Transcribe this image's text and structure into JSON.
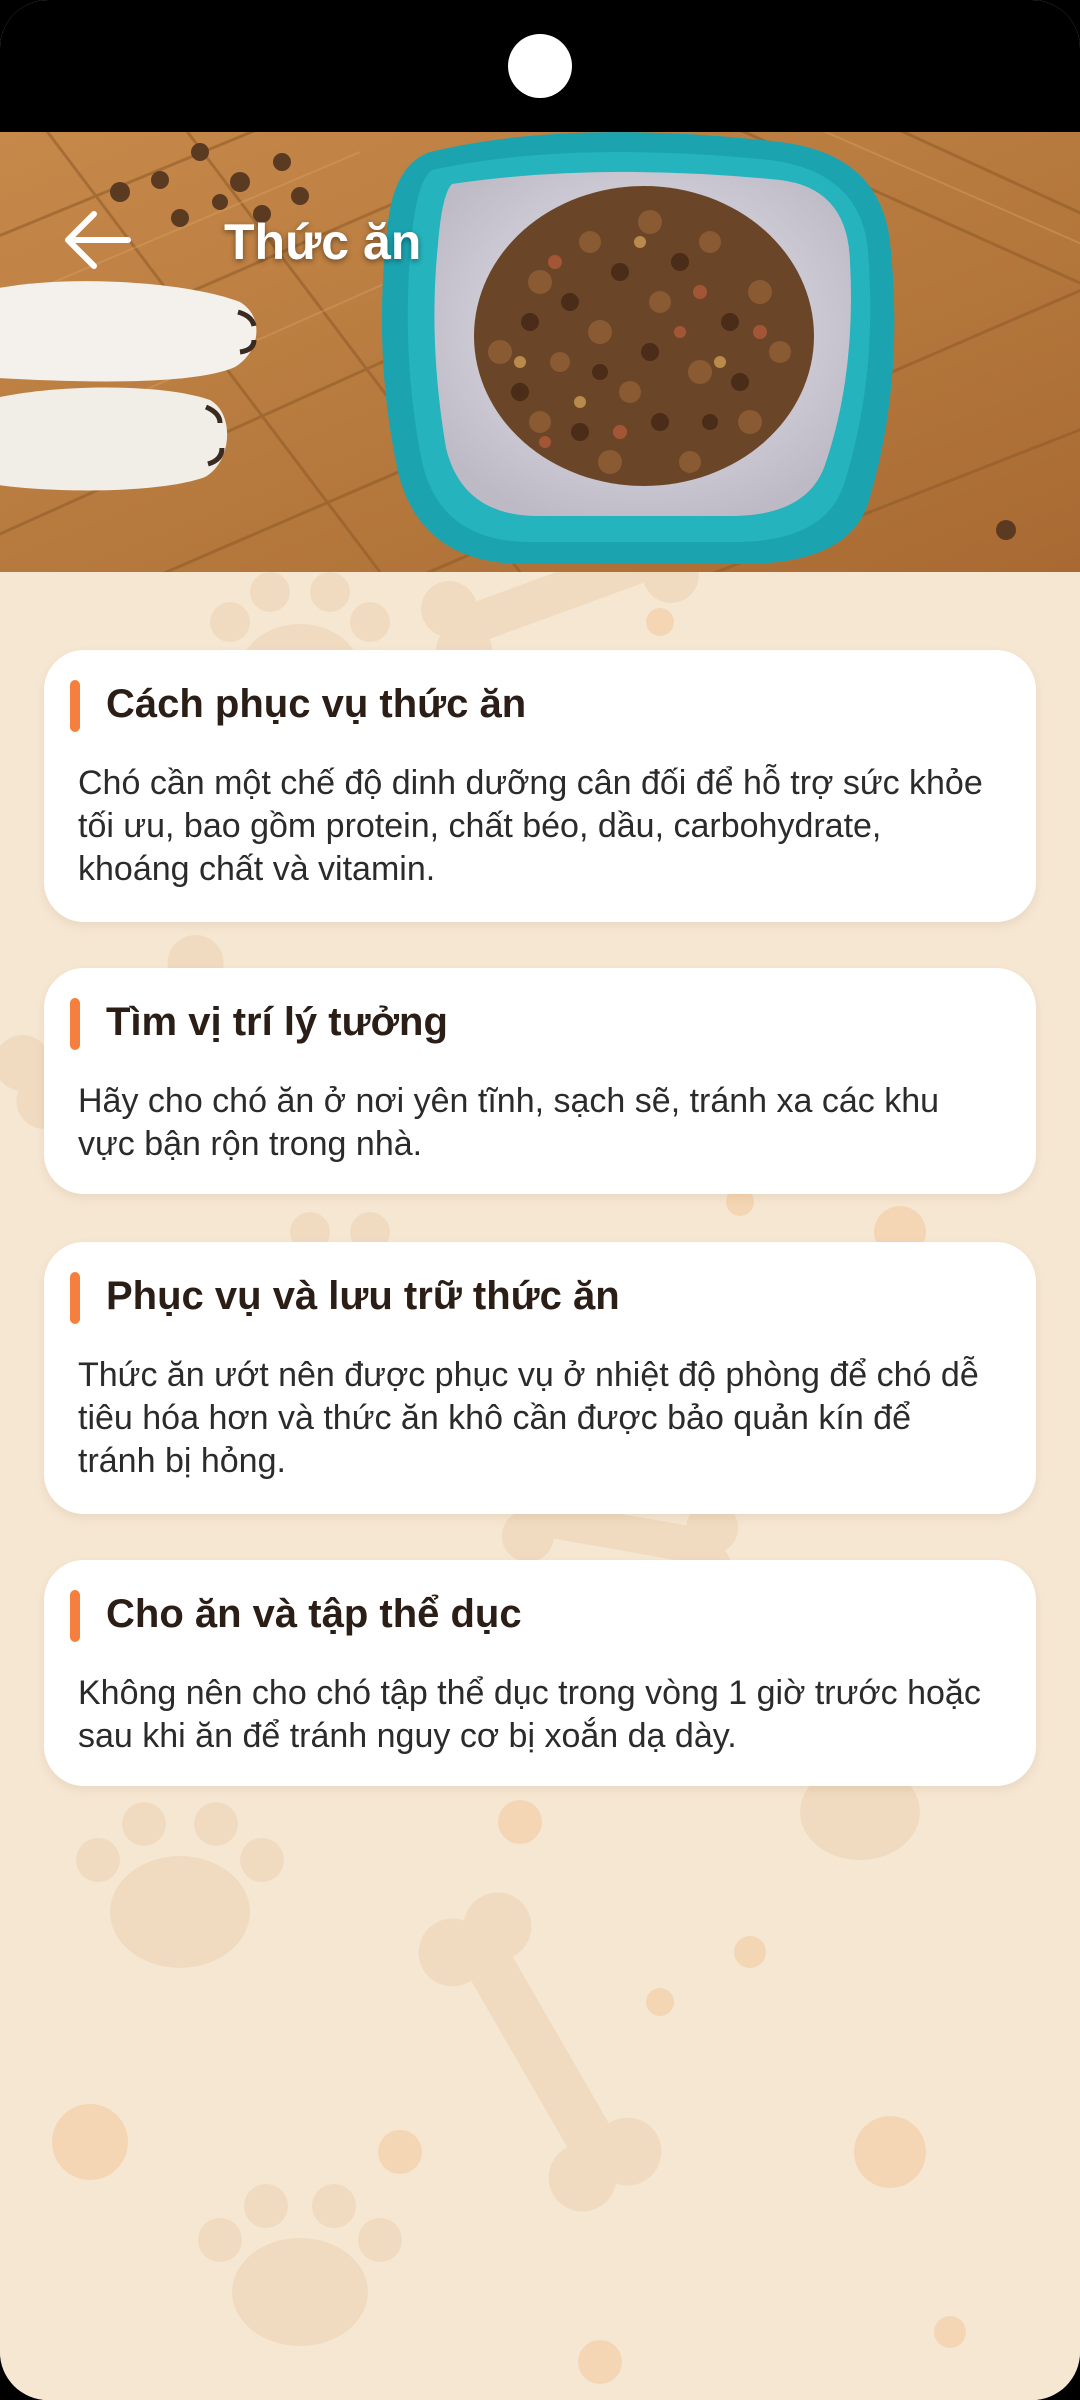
{
  "header": {
    "title": "Thức ăn",
    "back_icon": "arrow-left-icon"
  },
  "theme": {
    "accent": "#f5803e",
    "background": "#f6e7d3",
    "card": "#ffffff",
    "title_text": "#2b1e16"
  },
  "cards": [
    {
      "title": "Cách phục vụ thức ăn",
      "body": "Chó cần một chế độ dinh dưỡng cân đối để hỗ trợ sức khỏe tối ưu, bao gồm protein, chất béo, dầu, carbohydrate, khoáng chất và vitamin."
    },
    {
      "title": "Tìm vị trí lý tưởng",
      "body": "Hãy cho chó ăn ở nơi yên tĩnh, sạch sẽ, tránh xa các khu vực bận rộn trong nhà."
    },
    {
      "title": "Phục vụ và lưu trữ thức ăn",
      "body": "Thức ăn ướt nên được phục vụ ở nhiệt độ phòng để chó dễ tiêu hóa hơn và thức ăn khô cần được bảo quản kín để tránh bị hỏng."
    },
    {
      "title": "Cho ăn và tập thể dục",
      "body": "Không nên cho chó tập thể dục trong vòng 1 giờ trước hoặc sau khi ăn để tránh nguy cơ bị xoắn dạ dày."
    }
  ]
}
